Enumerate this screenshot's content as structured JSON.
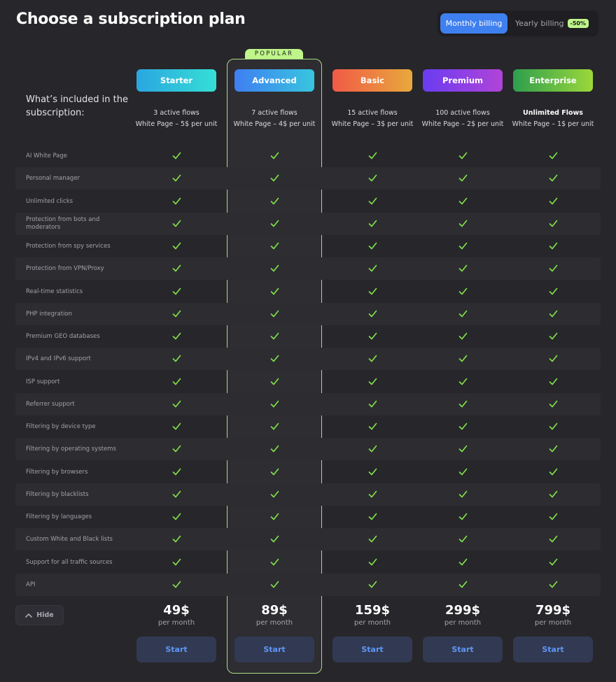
{
  "header": {
    "title": "Choose a subscription plan",
    "billing": {
      "monthly_label": "Monthly billing",
      "yearly_label": "Yearly billing",
      "yearly_discount": "-50%",
      "selected": "monthly"
    }
  },
  "popular_label": "POPULAR",
  "included_heading": "What’s included in the subscription:",
  "plans": [
    {
      "name": "Starter",
      "flows": "3 active flows",
      "white_page": "White Page – 5$ per unit",
      "price": "49$",
      "period": "per month",
      "cta": "Start",
      "gradient": [
        "#2aa6e0",
        "#36dfd6"
      ]
    },
    {
      "name": "Advanced",
      "flows": "7 active flows",
      "white_page": "White Page – 4$ per unit",
      "price": "89$",
      "period": "per month",
      "cta": "Start",
      "gradient": [
        "#3f7ef2",
        "#37c6de"
      ]
    },
    {
      "name": "Basic",
      "flows": "15 active flows",
      "white_page": "White Page – 3$ per unit",
      "price": "159$",
      "period": "per month",
      "cta": "Start",
      "gradient": [
        "#f15a47",
        "#e8a93c"
      ]
    },
    {
      "name": "Premium",
      "flows": "100 active flows",
      "white_page": "White Page – 2$ per unit",
      "price": "299$",
      "period": "per month",
      "cta": "Start",
      "gradient": [
        "#6a3cf0",
        "#b044d8"
      ]
    },
    {
      "name": "Enterprise",
      "flows": "Unlimited Flows",
      "white_page": "White Page – 1$ per unit",
      "price": "799$",
      "period": "per month",
      "cta": "Start",
      "gradient": [
        "#2e9e4e",
        "#9bd83a"
      ]
    }
  ],
  "features": [
    "AI White Page",
    "Personal manager",
    "Unlimited clicks",
    "Protection from bots and moderators",
    "Protection from spy services",
    "Protection from VPN/Proxy",
    "Real-time statistics",
    "PHP integration",
    "Premium GEO databases",
    "IPv4 and IPv6 support",
    "ISP support",
    "Referrer support",
    "Filtering by device type",
    "Filtering by operating systems",
    "Filtering by browsers",
    "Filtering by blacklists",
    "Filtering by languages",
    "Custom White and Black lists",
    "Support for all traffic sources",
    "API"
  ],
  "feature_icon": "check-icon",
  "colors": {
    "check": "#7ee04a",
    "accent": "#3f80f0",
    "popular_border": "#a9dc83"
  },
  "hide_label": "Hide",
  "hide_icon": "chevron-up-icon"
}
